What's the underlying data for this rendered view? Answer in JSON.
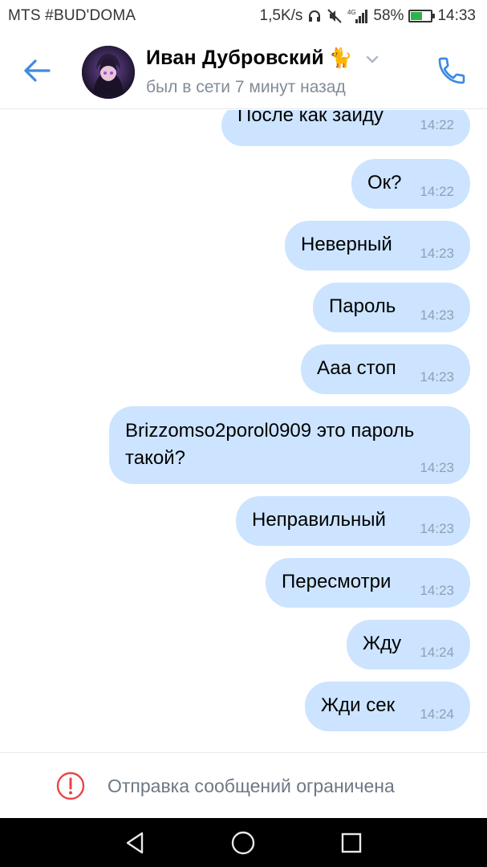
{
  "status_bar": {
    "carrier": "MTS #BUD'DOMA",
    "speed": "1,5K/s",
    "network": "4G",
    "battery": "58%",
    "battery_level": 0.58,
    "time": "14:33"
  },
  "header": {
    "contact_name": "Иван Дубровский",
    "name_emoji": "🐈",
    "last_seen": "был в сети 7 минут назад",
    "icons": [
      "back-arrow-icon",
      "chevron-down-icon",
      "phone-icon"
    ]
  },
  "messages": [
    {
      "text": "После как зайду",
      "time": "14:22"
    },
    {
      "text": "Ок?",
      "time": "14:22"
    },
    {
      "text": "Неверный",
      "time": "14:23"
    },
    {
      "text": "Пароль",
      "time": "14:23"
    },
    {
      "text": "Ааа стоп",
      "time": "14:23"
    },
    {
      "text": "Brizzomso2porol0909 это пароль",
      "text_line2": "такой?",
      "time": "14:23"
    },
    {
      "text": "Неправильный",
      "time": "14:23"
    },
    {
      "text": "Пересмотри",
      "time": "14:23"
    },
    {
      "text": "Жду",
      "time": "14:24"
    },
    {
      "text": "Жди сек",
      "time": "14:24"
    }
  ],
  "footer": {
    "notice": "Отправка сообщений ограничена",
    "icon": "warning-circle-icon"
  },
  "nav_bar": {
    "icons": [
      "back-triangle-icon",
      "home-circle-icon",
      "recents-square-icon"
    ]
  },
  "colors": {
    "accent": "#3f8ae0",
    "bubble": "#cce4ff",
    "time": "#8ea0b5",
    "warning": "#e64646",
    "battery_fill": "#2fb24a"
  }
}
